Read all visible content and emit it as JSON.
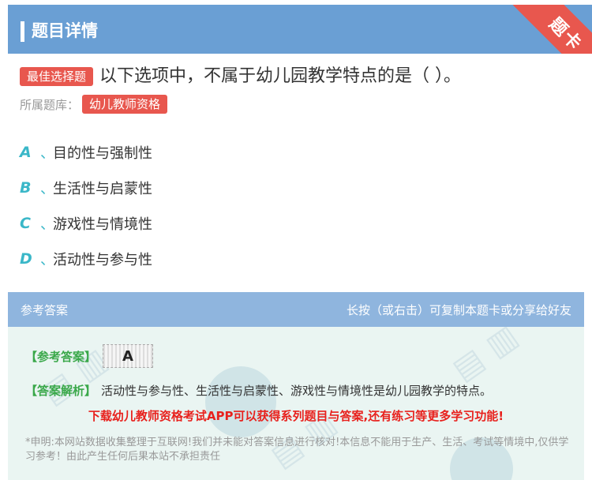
{
  "header": {
    "title": "题目详情",
    "ribbon": "题卡"
  },
  "question": {
    "type_tag": "最佳选择题",
    "text": "以下选项中，不属于幼儿园教学特点的是（ ）。",
    "library_label": "所属题库：",
    "library_tag": "幼儿教师资格"
  },
  "options": [
    {
      "letter": "A",
      "sep": "、",
      "text": "目的性与强制性"
    },
    {
      "letter": "B",
      "sep": "、",
      "text": "生活性与启蒙性"
    },
    {
      "letter": "C",
      "sep": "、",
      "text": "游戏性与情境性"
    },
    {
      "letter": "D",
      "sep": "、",
      "text": "活动性与参与性"
    }
  ],
  "answer": {
    "head_left": "参考答案",
    "head_right": "长按（或右击）可复制本题卡或分享给好友",
    "ref_label": "【参考答案】",
    "ref_value": "A",
    "analysis_label": "【答案解析】",
    "analysis_text": "活动性与参与性、生活性与启蒙性、游戏性与情境性是幼儿园教学的特点。",
    "promo": "下载幼儿教师资格考试APP可以获得系列题目与答案,还有练习等更多学习功能!",
    "disclaimer": "*申明:本网站数据收集整理于互联网!我们并未能对答案信息进行核对!本信息不能用于生产、生活、考试等情境中,仅供学习参考！由此产生任何后果本站不承担责任"
  },
  "colors": {
    "header": "#6a9fd4",
    "accent_red": "#e8574e",
    "option_letter": "#3ab7c8",
    "green": "#3aa84a",
    "promo_red": "#e8211d"
  }
}
